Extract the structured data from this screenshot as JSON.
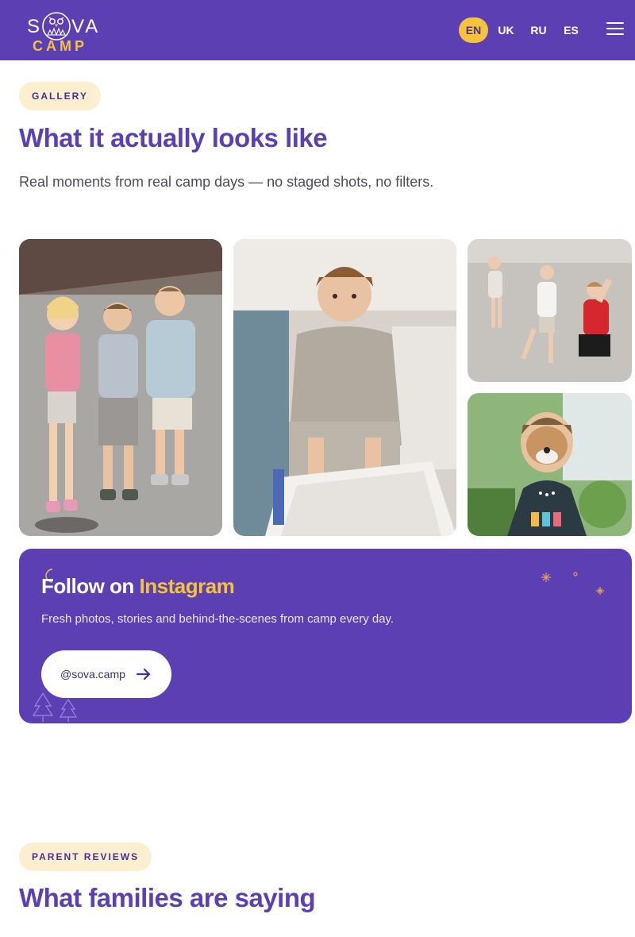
{
  "brand": {
    "logo_left": "S",
    "logo_right": "VA",
    "logo_sub": "CAMP",
    "colors": {
      "primary": "#5b3fb3",
      "accent": "#f5c33b",
      "pill_bg": "#fbefcf"
    }
  },
  "nav": {
    "languages": [
      {
        "label": "EN",
        "active": true
      },
      {
        "label": "UK",
        "active": false
      },
      {
        "label": "RU",
        "active": false
      },
      {
        "label": "ES",
        "active": false
      }
    ],
    "menu_icon": "hamburger-icon"
  },
  "gallery": {
    "badge": "GALLERY",
    "title": "What it actually looks like",
    "subtitle": "Real moments from real camp days — no staged shots, no filters.",
    "photos": [
      {
        "name": "three-kids-photo"
      },
      {
        "name": "boy-crafting-photo"
      },
      {
        "name": "kids-playing-photo"
      },
      {
        "name": "face-paint-boy-photo"
      }
    ]
  },
  "instagram": {
    "title_prefix": "Follow on ",
    "title_accent": "Instagram",
    "subtitle": "Fresh photos, stories and behind-the-scenes from camp every day.",
    "button_label": "@sova.camp",
    "button_icon": "arrow-right-icon"
  },
  "reviews": {
    "badge": "PARENT REVIEWS",
    "title": "What families are saying"
  }
}
